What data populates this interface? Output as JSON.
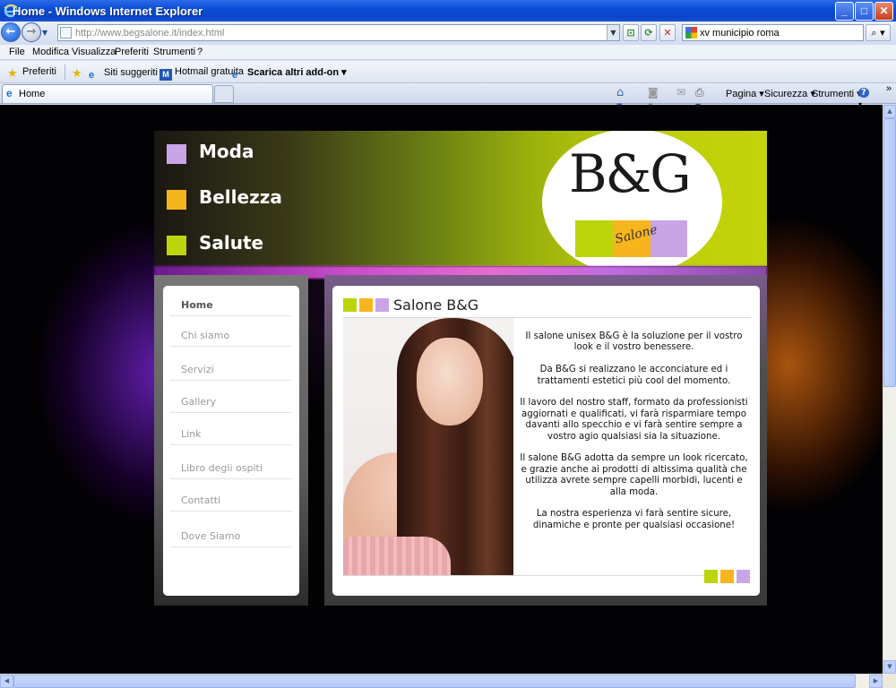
{
  "browser": {
    "window_title": "Home - Windows Internet Explorer",
    "address_url": "http://www.begsalone.it/index.html",
    "search_value": "xv municipio roma",
    "menu": [
      "File",
      "Modifica",
      "Visualizza",
      "Preferiti",
      "Strumenti",
      "?"
    ],
    "favorites": {
      "favorites_label": "Preferiti",
      "links": [
        "Siti suggeriti ▾",
        "Hotmail gratuita",
        "Scarica altri add-on ▾"
      ]
    },
    "tab_title": "Home",
    "commands": [
      "Pagina ▾",
      "Sicurezza ▾",
      "Strumenti ▾"
    ],
    "icons": [
      "ie-logo-icon",
      "back-arrow-icon",
      "forward-arrow-icon",
      "refresh-icon",
      "stop-icon",
      "search-magnifier-icon",
      "star-icon",
      "home-icon",
      "rss-icon",
      "print-icon",
      "help-icon"
    ]
  },
  "site": {
    "header_items": [
      {
        "label": "Moda",
        "color": "#c9a4e6"
      },
      {
        "label": "Bellezza",
        "color": "#f7b51d"
      },
      {
        "label": "Salute",
        "color": "#bcd40a"
      }
    ],
    "logo_text": "B&G",
    "logo_subtitle": "Salone",
    "nav": [
      "Home",
      "Chi siamo",
      "Servizi",
      "Gallery",
      "Link",
      "Libro degli ospiti",
      "Contatti",
      "Dove Siamo"
    ],
    "main_title": "Salone B&G",
    "paragraphs": [
      "Il salone unisex B&G è la soluzione per il vostro look e il vostro benessere.",
      "Da B&G si realizzano le acconciature ed i trattamenti estetici più cool del momento.",
      "Il lavoro del nostro staff, formato da professionisti aggiornati e qualificati, vi farà risparmiare tempo davanti allo specchio e vi farà sentire sempre a vostro agio qualsiasi sia la situazione.",
      "Il salone B&G adotta da sempre un look ricercato, e grazie anche ai prodotti di altissima qualità che utilizza avrete sempre capelli morbidi, lucenti e alla moda.",
      "La nostra esperienza vi farà sentire sicure, dinamiche e pronte per qualsiasi occasione!"
    ],
    "colors": {
      "lime": "#bcd40a",
      "orange": "#f7b51d",
      "lilac": "#c9a4e6"
    }
  }
}
